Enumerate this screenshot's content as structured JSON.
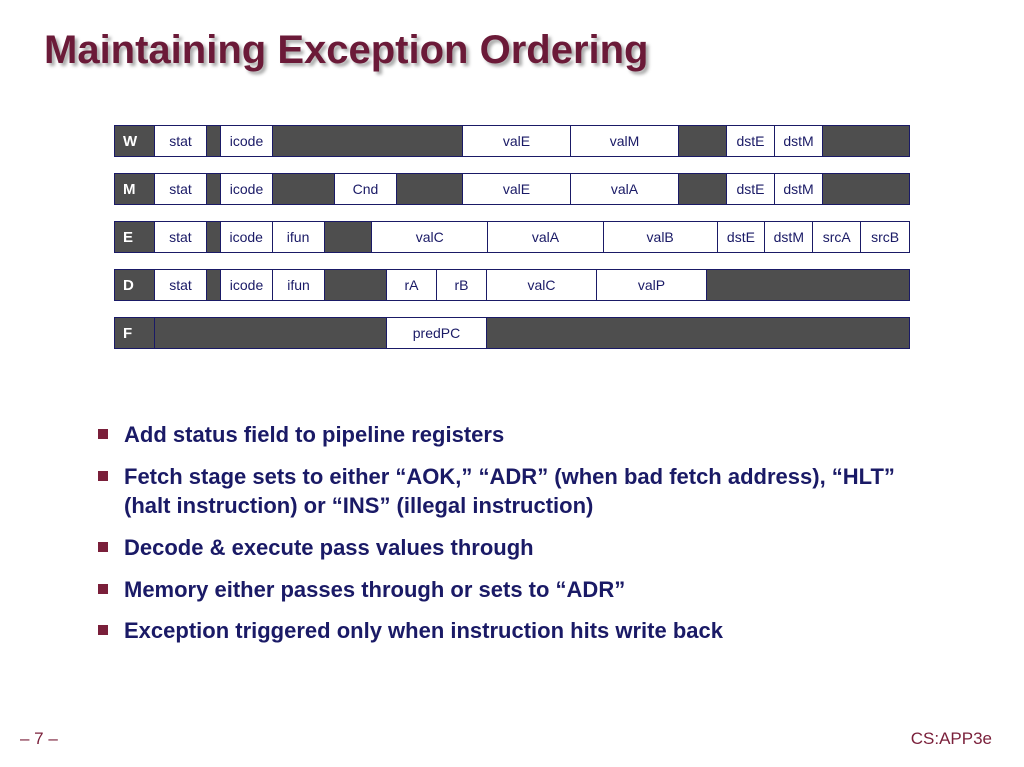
{
  "title": "Maintaining Exception Ordering",
  "rows": {
    "W": {
      "label": "W",
      "cells": [
        "stat",
        "",
        "icode",
        "",
        "",
        "",
        "valE",
        "valM",
        "",
        "dstE",
        "dstM",
        ""
      ]
    },
    "M": {
      "label": "M",
      "cells": [
        "stat",
        "",
        "icode",
        "",
        "Cnd",
        "",
        "valE",
        "valA",
        "",
        "dstE",
        "dstM",
        ""
      ]
    },
    "E": {
      "label": "E",
      "cells": [
        "stat",
        "",
        "icode",
        "ifun",
        "",
        "valC",
        "valA",
        "valB",
        "dstE",
        "dstM",
        "srcA",
        "srcB"
      ]
    },
    "D": {
      "label": "D",
      "cells": [
        "stat",
        "",
        "icode",
        "ifun",
        "",
        "rA",
        "rB",
        "valC",
        "valP",
        ""
      ]
    },
    "F": {
      "label": "F",
      "cells": [
        "",
        "predPC",
        ""
      ]
    }
  },
  "bullets": [
    "Add status field to pipeline registers",
    "Fetch stage sets to either “AOK,” “ADR” (when bad fetch address), “HLT” (halt instruction) or “INS” (illegal instruction)",
    "Decode & execute pass values through",
    "Memory either passes through or sets to “ADR”",
    "Exception triggered only when instruction hits write back"
  ],
  "footer": {
    "left": "– 7 –",
    "right": "CS:APP3e"
  }
}
